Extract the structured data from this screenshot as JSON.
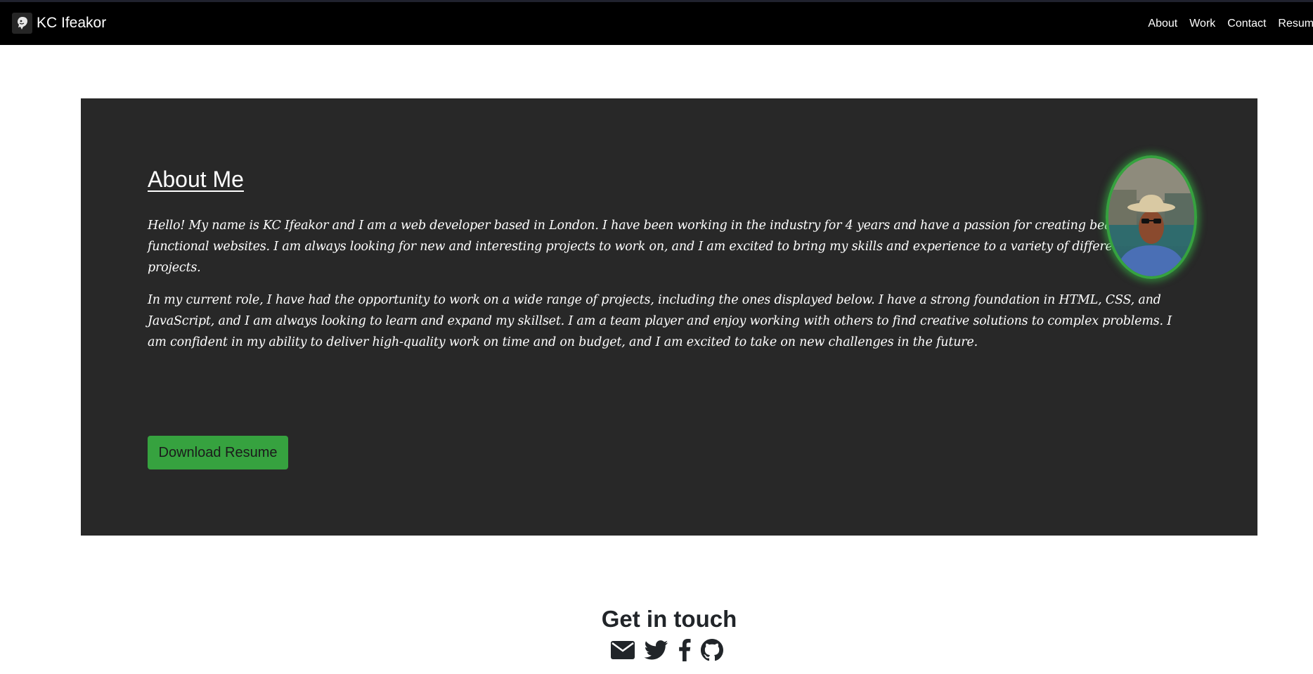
{
  "navbar": {
    "brand": {
      "name": "KC Ifeakor",
      "logo_icon": "lion-head-icon"
    },
    "links": [
      {
        "label": "About"
      },
      {
        "label": "Work"
      },
      {
        "label": "Contact"
      },
      {
        "label": "Resume"
      }
    ]
  },
  "about": {
    "title": "About Me",
    "paragraphs": [
      "Hello! My name is KC Ifeakor and I am a web developer based in London. I have been working in the industry for 4 years and have a passion for creating beautiful and functional websites. I am always looking for new and interesting projects to work on, and I am excited to bring my skills and experience to a variety of different projects.",
      "In my current role, I have had the opportunity to work on a wide range of projects, including the ones displayed below. I have a strong foundation in HTML, CSS, and JavaScript, and I am always looking to learn and expand my skillset. I am a team player and enjoy working with others to find creative solutions to complex problems. I am confident in my ability to deliver high-quality work on time and on budget, and I am excited to take on new challenges in the future."
    ],
    "button_label": "Download Resume",
    "avatar_icon": "profile-photo"
  },
  "contact": {
    "title": "Get in touch",
    "icons": [
      "envelope-icon",
      "twitter-icon",
      "facebook-icon",
      "github-icon"
    ]
  },
  "colors": {
    "accent": "#36a23f",
    "navbar_bg": "#000000",
    "panel_bg": "#282828",
    "heading_text": "#212529"
  }
}
